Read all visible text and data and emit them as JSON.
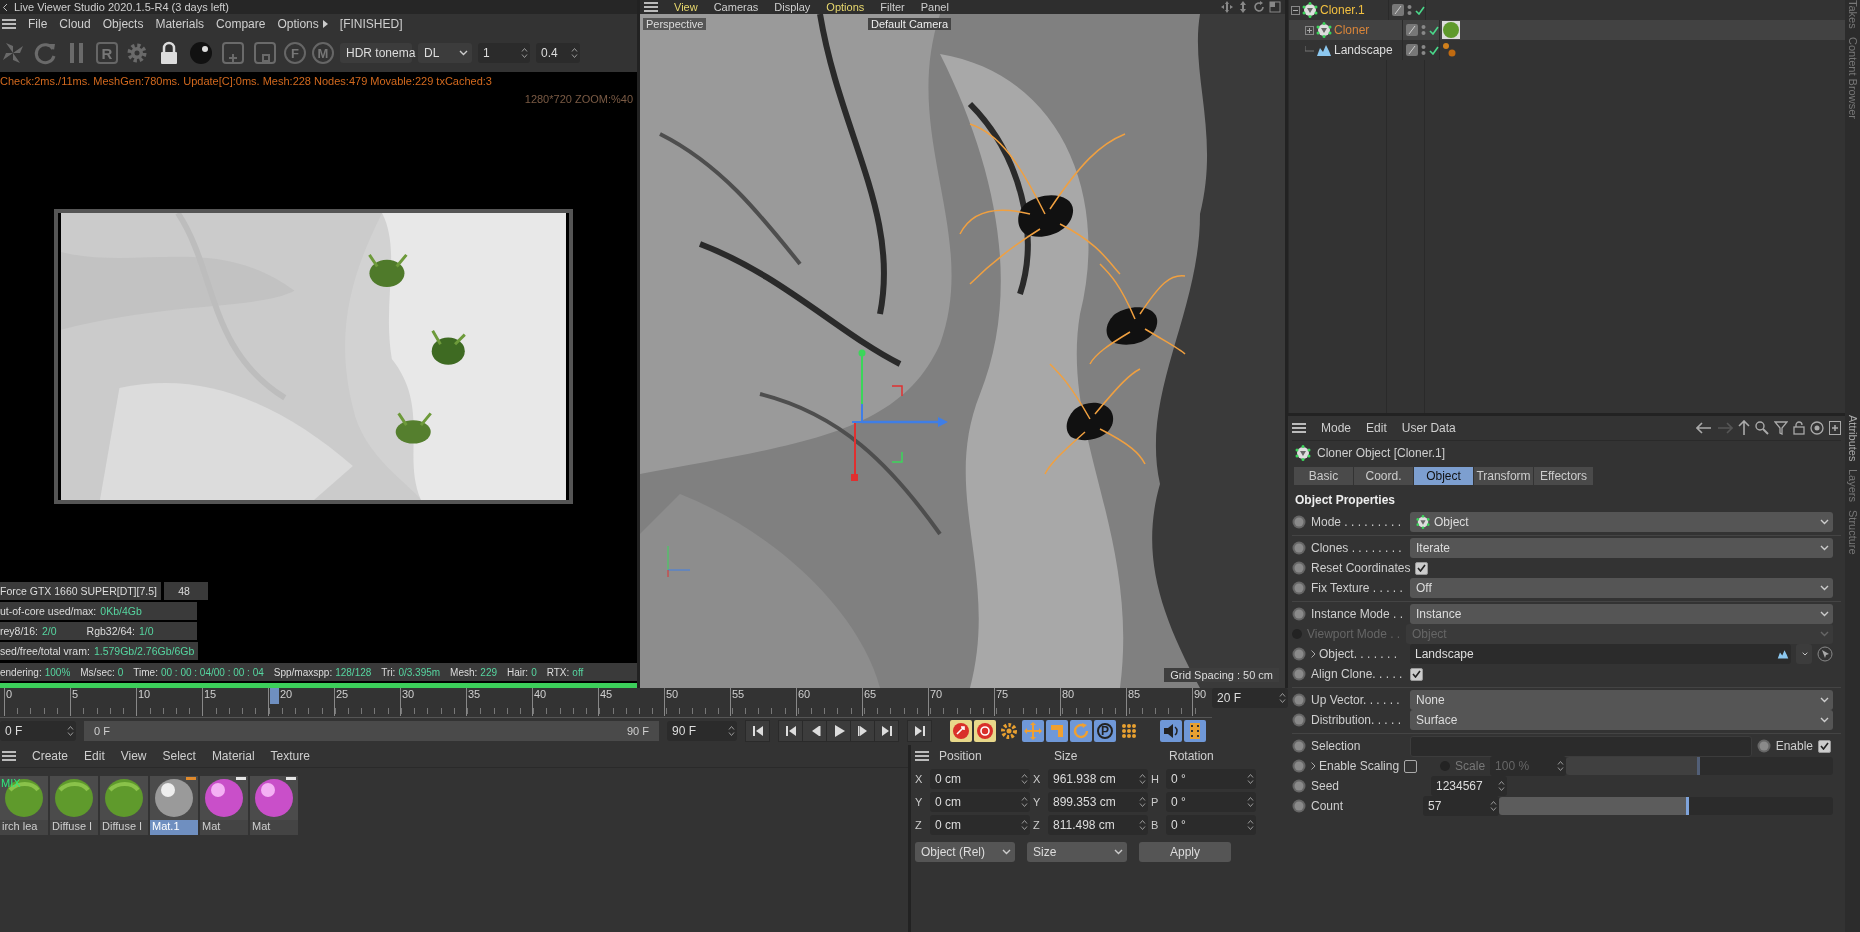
{
  "live_viewer": {
    "title": "Live Viewer Studio 2020.1.5-R4 (3 days left)",
    "menu": [
      {
        "label": "File",
        "submenu": false
      },
      {
        "label": "Cloud",
        "submenu": false
      },
      {
        "label": "Objects",
        "submenu": false
      },
      {
        "label": "Materials",
        "submenu": false
      },
      {
        "label": "Compare",
        "submenu": false
      },
      {
        "label": "Options",
        "submenu": true
      }
    ],
    "render_state": "[FINISHED]",
    "toolbar": [
      {
        "kind": "pinwheel"
      },
      {
        "kind": "refresh"
      },
      {
        "kind": "pause"
      },
      {
        "kind": "letter",
        "label": "R"
      },
      {
        "kind": "gear"
      },
      {
        "kind": "lock"
      },
      {
        "kind": "sphere"
      },
      {
        "kind": "add"
      },
      {
        "kind": "remove"
      },
      {
        "kind": "pin",
        "label": "F"
      },
      {
        "kind": "pin",
        "label": "M"
      }
    ],
    "tonemap": "HDR tonema",
    "kernel": "DL",
    "spinners": [
      "1",
      "0.4"
    ],
    "status_line": "Check:2ms./11ms. MeshGen:780ms. Update[C]:0ms. Mesh:228 Nodes:479 Movable:229 txCached:3",
    "resolution": "1280*720 ZOOM:%40",
    "render": {
      "kind": "picture"
    },
    "stats": [
      [
        {
          "kind": "label",
          "text": "Force GTX 1660 SUPER[DT][7.5]"
        },
        {
          "kind": "cell",
          "text": "48"
        }
      ],
      [
        {
          "kind": "label",
          "text": "ut-of-core used/max:"
        },
        {
          "kind": "value",
          "text": "0Kb/4Gb"
        }
      ],
      [
        {
          "kind": "label",
          "text": "rey8/16:"
        },
        {
          "kind": "value",
          "text": "2/0"
        },
        {
          "kind": "label",
          "text": "Rgb32/64:"
        },
        {
          "kind": "value",
          "text": "1/0"
        }
      ],
      [
        {
          "kind": "label",
          "text": "sed/free/total vram:"
        },
        {
          "kind": "value",
          "text": "1.579Gb/2.76Gb/6Gb"
        }
      ]
    ],
    "render_status": [
      {
        "kind": "label",
        "text": "endering:"
      },
      {
        "kind": "value",
        "text": "100%"
      },
      {
        "kind": "label",
        "text": "Ms/sec:"
      },
      {
        "kind": "value",
        "text": "0"
      },
      {
        "kind": "label",
        "text": "Time:"
      },
      {
        "kind": "value",
        "text": "00 : 00 : 04/00 : 00 : 04"
      },
      {
        "kind": "label",
        "text": "Spp/maxspp:"
      },
      {
        "kind": "value",
        "text": "128/128"
      },
      {
        "kind": "label",
        "text": "Tri:"
      },
      {
        "kind": "value",
        "text": "0/3.395m"
      },
      {
        "kind": "label",
        "text": "Mesh:"
      },
      {
        "kind": "value",
        "text": "229"
      },
      {
        "kind": "label",
        "text": "Hair:"
      },
      {
        "kind": "value",
        "text": "0"
      },
      {
        "kind": "label",
        "text": "RTX:"
      },
      {
        "kind": "value",
        "text": "off"
      }
    ],
    "progress": {
      "level": 1
    }
  },
  "viewport": {
    "menu": [
      {
        "label": "View",
        "highlighted": true
      },
      {
        "label": "Cameras",
        "highlighted": false
      },
      {
        "label": "Display",
        "highlighted": false
      },
      {
        "label": "Options",
        "highlighted": true
      },
      {
        "label": "Filter",
        "highlighted": false
      },
      {
        "label": "Panel",
        "highlighted": false
      }
    ],
    "camera_label": "Perspective",
    "camera_name": "Default Camera",
    "grid_spacing": "Grid Spacing : 50 cm",
    "scene": {
      "kind": "picture"
    }
  },
  "timeline": {
    "ticks": [
      {
        "label": "0",
        "selected": false
      },
      {
        "label": "5",
        "selected": false
      },
      {
        "label": "10",
        "selected": false
      },
      {
        "label": "15",
        "selected": false
      },
      {
        "label": "20",
        "selected": true
      },
      {
        "label": "25",
        "selected": false
      },
      {
        "label": "30",
        "selected": false
      },
      {
        "label": "35",
        "selected": false
      },
      {
        "label": "40",
        "selected": false
      },
      {
        "label": "45",
        "selected": false
      },
      {
        "label": "50",
        "selected": false
      },
      {
        "label": "55",
        "selected": false
      },
      {
        "label": "60",
        "selected": false
      },
      {
        "label": "65",
        "selected": false
      },
      {
        "label": "70",
        "selected": false
      },
      {
        "label": "75",
        "selected": false
      },
      {
        "label": "80",
        "selected": false
      },
      {
        "label": "85",
        "selected": false
      },
      {
        "label": "90",
        "selected": false
      }
    ],
    "current_frame": "20 F",
    "start": "0 F",
    "range": {
      "start": "0 F",
      "end": "90 F",
      "level": 1
    },
    "end": "90 F",
    "tools": [
      {
        "kind": "record"
      },
      {
        "kind": "autokey"
      },
      {
        "kind": "keygear"
      },
      {
        "kind": "move"
      },
      {
        "kind": "scale"
      },
      {
        "kind": "rotate"
      },
      {
        "kind": "param",
        "label": "P"
      },
      {
        "kind": "grid"
      },
      {
        "kind": "sound"
      },
      {
        "kind": "film"
      }
    ]
  },
  "material_manager": {
    "menu": [
      "Create",
      "Edit",
      "View",
      "Select",
      "Material",
      "Texture"
    ],
    "materials": [
      {
        "name": "irch lea",
        "kind": "leaf",
        "badge": "MIX",
        "selected": false
      },
      {
        "name": "Diffuse I",
        "kind": "leaf",
        "selected": false
      },
      {
        "name": "Diffuse I",
        "kind": "leaf",
        "selected": false
      },
      {
        "name": "Mat.1",
        "kind": "grey",
        "selected": true,
        "color": "#e08a2c"
      },
      {
        "name": "Mat",
        "kind": "pink",
        "selected": false,
        "color": "#e6e6e6"
      },
      {
        "name": "Mat",
        "kind": "pink",
        "selected": false,
        "color": "#e6e6e6"
      }
    ]
  },
  "coordinates": {
    "headers": [
      "Position",
      "Size",
      "Rotation"
    ],
    "rows": [
      {
        "axis": "X",
        "position": "0 cm",
        "size_axis": "X",
        "size": "961.938 cm",
        "rotation_axis": "H",
        "rotation": "0 °"
      },
      {
        "axis": "Y",
        "position": "0 cm",
        "size_axis": "Y",
        "size": "899.353 cm",
        "rotation_axis": "P",
        "rotation": "0 °"
      },
      {
        "axis": "Z",
        "position": "0 cm",
        "size_axis": "Z",
        "size": "811.498 cm",
        "rotation_axis": "B",
        "rotation": "0 °"
      }
    ],
    "space": "Object (Rel)",
    "mode": "Size",
    "apply": "Apply"
  },
  "object_manager": {
    "objects": [
      {
        "name": "Cloner.1",
        "kind": "cloner",
        "color": "#f2c040",
        "expanded": true,
        "selected": false,
        "children": [
          {
            "name": "Cloner",
            "kind": "cloner",
            "color": "#d9853a",
            "expanded": false,
            "selected": true,
            "tags": [
              {
                "kind": "material"
              }
            ]
          },
          {
            "name": "Landscape",
            "kind": "landscape",
            "color": "#dddddd",
            "selected": false,
            "tags": [
              {
                "kind": "points"
              }
            ]
          }
        ]
      }
    ]
  },
  "attributes": {
    "menu": [
      "Mode",
      "Edit",
      "User Data"
    ],
    "title": "Cloner Object [Cloner.1]",
    "tabs": [
      {
        "label": "Basic",
        "selected": false
      },
      {
        "label": "Coord.",
        "selected": false
      },
      {
        "label": "Object",
        "selected": true
      },
      {
        "label": "Transform",
        "selected": false
      },
      {
        "label": "Effectors",
        "selected": false
      }
    ],
    "section": "Object Properties",
    "groups": [
      [
        {
          "kind": "dropdown",
          "label": "Mode . . . . . . . . .",
          "value": "Object",
          "value_icon": true,
          "disabled": false
        }
      ],
      [
        {
          "kind": "dropdown",
          "label": "Clones . . . . . . . .",
          "value": "Iterate",
          "disabled": false
        },
        {
          "kind": "checkbox",
          "label": "Reset Coordinates",
          "checked": true
        },
        {
          "kind": "dropdown",
          "label": "Fix Texture . . . . .",
          "value": "Off",
          "disabled": false
        }
      ],
      [
        {
          "kind": "dropdown",
          "label": "Instance Mode . .",
          "value": "Instance",
          "disabled": false
        },
        {
          "kind": "dropdown",
          "label": "Viewport Mode . .",
          "value": "Object",
          "disabled": true
        },
        {
          "kind": "link",
          "label": "Object. . . . . . .",
          "value": "Landscape"
        },
        {
          "kind": "checkbox",
          "label": "Align Clone. . . . .",
          "checked": true
        }
      ],
      [
        {
          "kind": "dropdown",
          "label": "Up Vector. . . . . .",
          "value": "None",
          "disabled": false
        },
        {
          "kind": "dropdown",
          "label": "Distribution. . . . .",
          "value": "Surface",
          "disabled": false
        }
      ],
      [
        {
          "kind": "selection",
          "label": "Selection",
          "toggle_label": "Enable",
          "checked": true
        },
        {
          "kind": "scaling",
          "label": "Enable Scaling",
          "checked": false,
          "scale_label": "Scale",
          "value": "100 %",
          "level": 0.5
        },
        {
          "kind": "number",
          "label": "Seed",
          "value": "1234567"
        },
        {
          "kind": "slider",
          "label": "Count",
          "value": "57",
          "level": 0.57
        }
      ]
    ]
  },
  "side_tabs": [
    {
      "label": "Takes",
      "selected": false
    },
    {
      "label": "Content Browser",
      "selected": false
    },
    {
      "label": "Attributes",
      "selected": true
    },
    {
      "label": "Layers",
      "selected": false
    },
    {
      "label": "Structure",
      "selected": false
    }
  ]
}
